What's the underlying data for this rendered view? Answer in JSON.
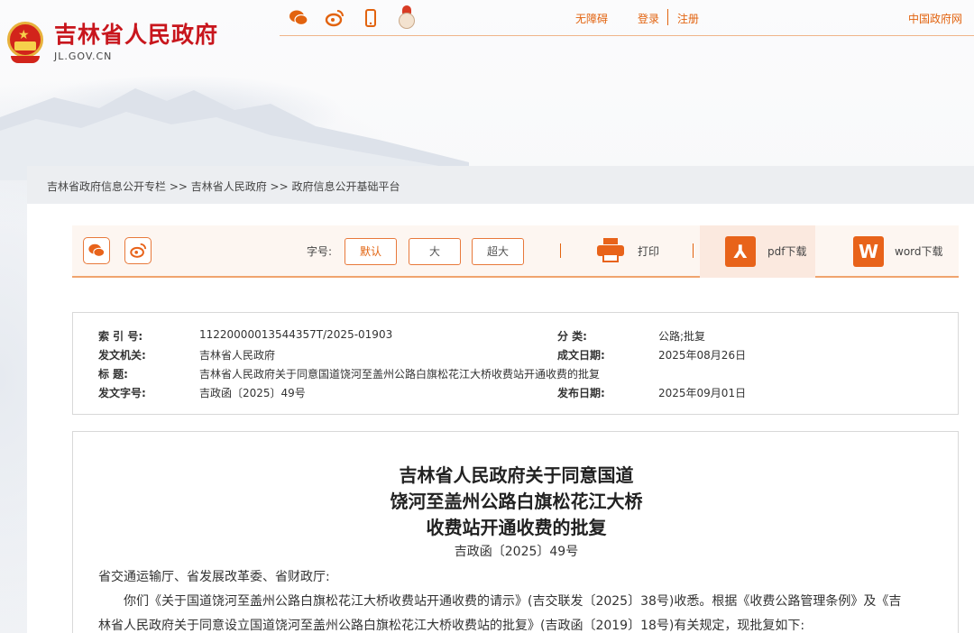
{
  "header": {
    "site_title": "吉林省人民政府",
    "site_domain": "JL.GOV.CN",
    "accessibility": "无障碍",
    "login": "登录",
    "register": "注册",
    "national_portal": "中国政府网",
    "social_icons": [
      "wechat-icon",
      "weibo-icon",
      "mobile-icon",
      "mascot-icon"
    ]
  },
  "breadcrumb": "吉林省政府信息公开专栏 >> 吉林省人民政府 >> 政府信息公开基础平台",
  "toolbar": {
    "font_size_label": "字号:",
    "font_default": "默认",
    "font_large": "大",
    "font_xlarge": "超大",
    "print": "打印",
    "pdf_download": "pdf下载",
    "word_download": "word下载",
    "pdf_icon_glyph": "⅄",
    "word_icon_glyph": "W"
  },
  "meta": {
    "index_label": "索 引 号:",
    "index_value": "11220000013544357T/2025-01903",
    "category_label": "分 类:",
    "category_value": "公路;批复",
    "issuer_label": "发文机关:",
    "issuer_value": "吉林省人民政府",
    "created_label": "成文日期:",
    "created_value": "2025年08月26日",
    "title_label": "标 题:",
    "title_value": "吉林省人民政府关于同意国道饶河至盖州公路白旗松花江大桥收费站开通收费的批复",
    "docno_label": "发文字号:",
    "docno_value": "吉政函〔2025〕49号",
    "published_label": "发布日期:",
    "published_value": "2025年09月01日"
  },
  "article": {
    "title_line1": "吉林省人民政府关于同意国道",
    "title_line2": "饶河至盖州公路白旗松花江大桥",
    "title_line3": "收费站开通收费的批复",
    "doc_number": "吉政函〔2025〕49号",
    "recipients": "省交通运输厅、省发展改革委、省财政厅:",
    "para1_line1": "你们《关于国道饶河至盖州公路白旗松花江大桥收费站开通收费的请示》(吉交联发〔2025〕38号)收悉。根据《收费公路管理条例》及《吉",
    "para1_line2": "林省人民政府关于同意设立国道饶河至盖州公路白旗松花江大桥收费站的批复》(吉政函〔2019〕18号)有关规定，现批复如下:"
  }
}
